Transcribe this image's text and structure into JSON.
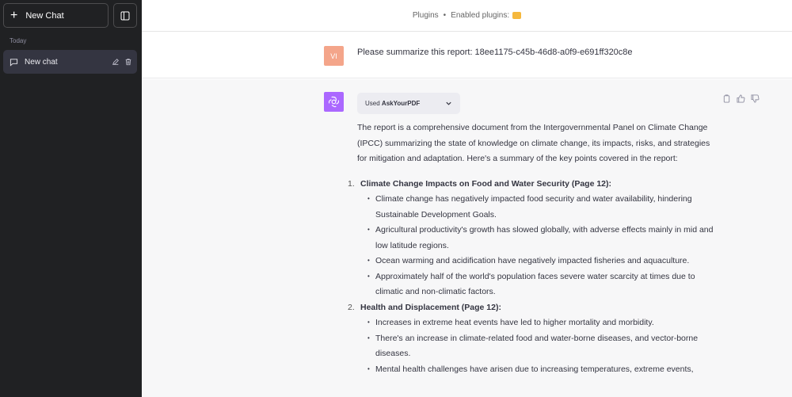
{
  "sidebar": {
    "new_chat_label": "New Chat",
    "section_today": "Today",
    "chats": [
      {
        "label": "New chat"
      }
    ]
  },
  "topbar": {
    "plugins_label": "Plugins",
    "enabled_label": "Enabled plugins:"
  },
  "user_message": {
    "avatar_initials": "VI",
    "text": "Please summarize this report: 18ee1175-c45b-46d8-a0f9-e691ff320c8e"
  },
  "assistant": {
    "used_prefix": "Used",
    "plugin_name": "AskYourPDF",
    "intro": "The report is a comprehensive document from the Intergovernmental Panel on Climate Change (IPCC) summarizing the state of knowledge on climate change, its impacts, risks, and strategies for mitigation and adaptation. Here's a summary of the key points covered in the report:",
    "sections": [
      {
        "num": "1.",
        "heading": "Climate Change Impacts on Food and Water Security (Page 12):",
        "bullets": [
          "Climate change has negatively impacted food security and water availability, hindering Sustainable Development Goals.",
          "Agricultural productivity's growth has slowed globally, with adverse effects mainly in mid and low latitude regions.",
          "Ocean warming and acidification have negatively impacted fisheries and aquaculture.",
          "Approximately half of the world's population faces severe water scarcity at times due to climatic and non-climatic factors."
        ]
      },
      {
        "num": "2.",
        "heading": "Health and Displacement (Page 12):",
        "bullets": [
          "Increases in extreme heat events have led to higher mortality and morbidity.",
          "There's an increase in climate-related food and water-borne diseases, and vector-borne diseases.",
          "Mental health challenges have arisen due to increasing temperatures, extreme events,"
        ]
      }
    ]
  },
  "colors": {
    "sidebar_bg": "#202123",
    "user_avatar": "#f4a58a",
    "bot_avatar": "#ab68ff",
    "assistant_bg": "#f7f7f8",
    "plugin_badge": "#f5b83d"
  }
}
